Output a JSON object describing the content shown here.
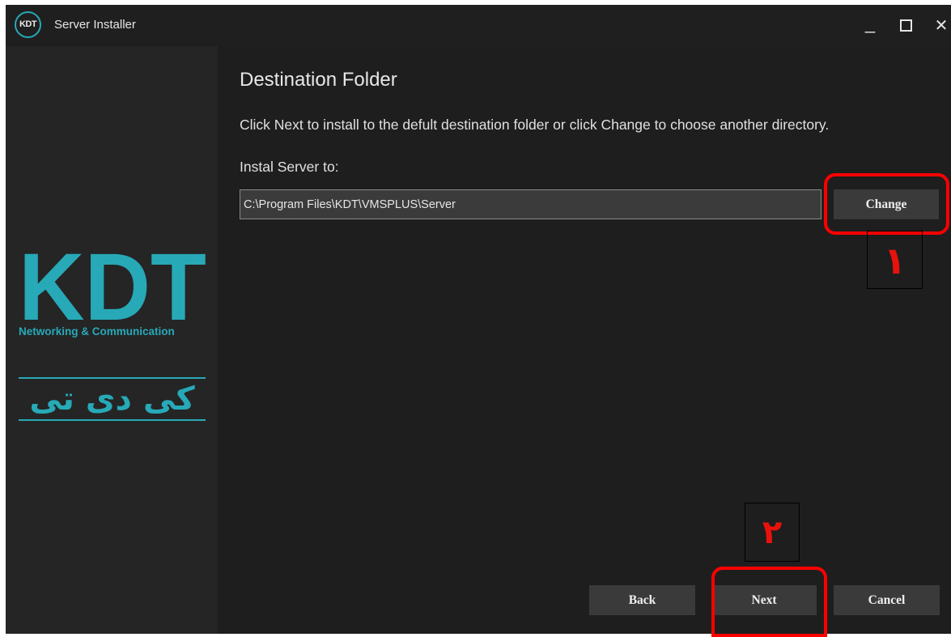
{
  "window": {
    "logo_text": "KDT",
    "title": "Server Installer",
    "minimize_glyph": "_",
    "close_glyph": "✕"
  },
  "brand": {
    "wordmark": "KDT",
    "tagline": "Networking & Communication",
    "arabic_name": "کی دی تی",
    "accent_color": "#27a9b7"
  },
  "page": {
    "title": "Destination Folder",
    "instruction": "Click Next to install to the defult destination folder or click Change to choose another directory.",
    "field_label": "Instal Server to:",
    "install_path": "C:\\Program Files\\KDT\\VMSPLUS\\Server"
  },
  "buttons": {
    "change": "Change",
    "back": "Back",
    "next": "Next",
    "cancel": "Cancel"
  },
  "annotations": {
    "highlight_color": "#ff0000",
    "step1_label": "١",
    "step2_label": "٢"
  }
}
